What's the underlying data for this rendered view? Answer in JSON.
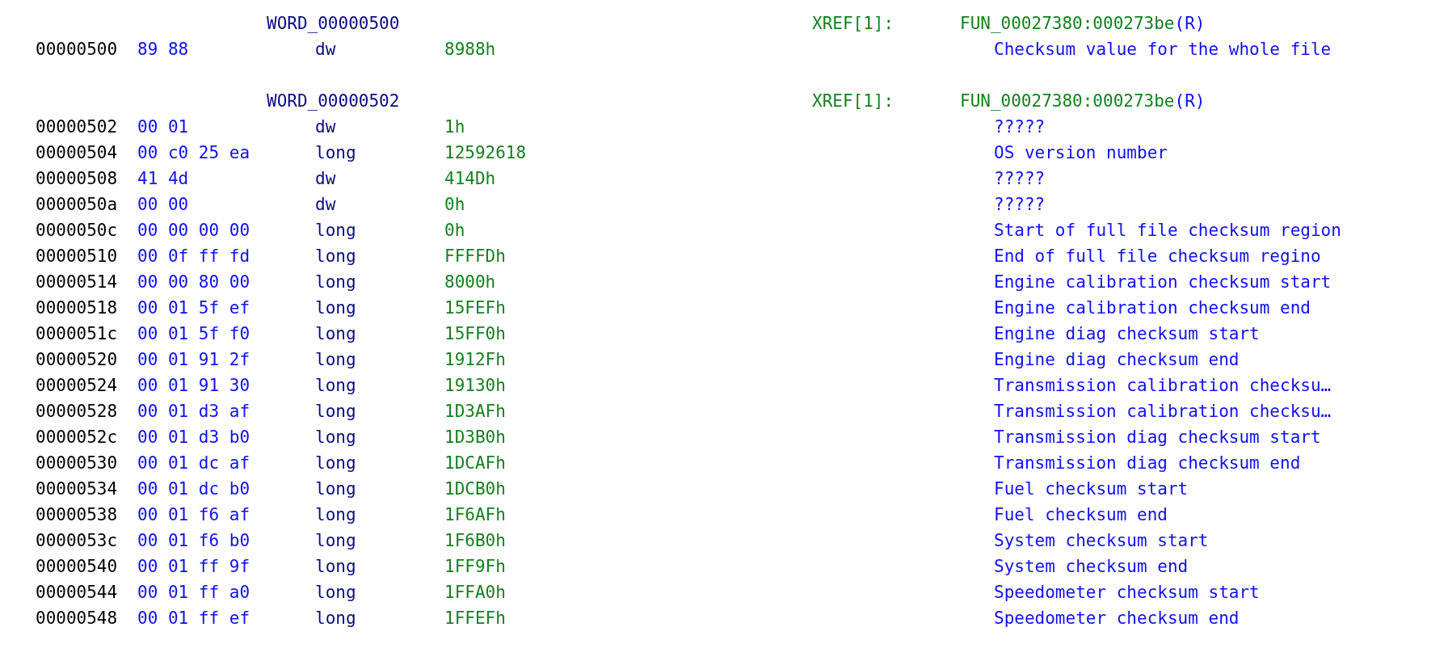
{
  "listing": [
    {
      "kind": "label",
      "label": "WORD_00000500",
      "xref_label": "XREF[1]:",
      "xref": "FUN_00027380:000273be",
      "access": "(R)"
    },
    {
      "kind": "data",
      "address": "00000500",
      "bytes": "89 88",
      "mnemonic": "dw",
      "operand": "8988h",
      "comment": "Checksum value for the whole file"
    },
    {
      "kind": "blank"
    },
    {
      "kind": "label",
      "label": "WORD_00000502",
      "xref_label": "XREF[1]:",
      "xref": "FUN_00027380:000273be",
      "access": "(R)"
    },
    {
      "kind": "data",
      "address": "00000502",
      "bytes": "00 01",
      "mnemonic": "dw",
      "operand": "1h",
      "comment": "?????"
    },
    {
      "kind": "data",
      "address": "00000504",
      "bytes": "00 c0 25 ea",
      "mnemonic": "long",
      "operand": "12592618",
      "comment": "OS version number"
    },
    {
      "kind": "data",
      "address": "00000508",
      "bytes": "41 4d",
      "mnemonic": "dw",
      "operand": "414Dh",
      "comment": "?????"
    },
    {
      "kind": "data",
      "address": "0000050a",
      "bytes": "00 00",
      "mnemonic": "dw",
      "operand": "0h",
      "comment": "?????"
    },
    {
      "kind": "data",
      "address": "0000050c",
      "bytes": "00 00 00 00",
      "mnemonic": "long",
      "operand": "0h",
      "comment": "Start of full file checksum region"
    },
    {
      "kind": "data",
      "address": "00000510",
      "bytes": "00 0f ff fd",
      "mnemonic": "long",
      "operand": "FFFFDh",
      "comment": "End of full file checksum regino"
    },
    {
      "kind": "data",
      "address": "00000514",
      "bytes": "00 00 80 00",
      "mnemonic": "long",
      "operand": "8000h",
      "comment": "Engine calibration checksum start"
    },
    {
      "kind": "data",
      "address": "00000518",
      "bytes": "00 01 5f ef",
      "mnemonic": "long",
      "operand": "15FEFh",
      "comment": "Engine calibration checksum end"
    },
    {
      "kind": "data",
      "address": "0000051c",
      "bytes": "00 01 5f f0",
      "mnemonic": "long",
      "operand": "15FF0h",
      "comment": "Engine diag checksum start"
    },
    {
      "kind": "data",
      "address": "00000520",
      "bytes": "00 01 91 2f",
      "mnemonic": "long",
      "operand": "1912Fh",
      "comment": "Engine diag checksum end"
    },
    {
      "kind": "data",
      "address": "00000524",
      "bytes": "00 01 91 30",
      "mnemonic": "long",
      "operand": "19130h",
      "comment": "Transmission calibration checksu…"
    },
    {
      "kind": "data",
      "address": "00000528",
      "bytes": "00 01 d3 af",
      "mnemonic": "long",
      "operand": "1D3AFh",
      "comment": "Transmission calibration checksu…"
    },
    {
      "kind": "data",
      "address": "0000052c",
      "bytes": "00 01 d3 b0",
      "mnemonic": "long",
      "operand": "1D3B0h",
      "comment": "Transmission diag checksum start"
    },
    {
      "kind": "data",
      "address": "00000530",
      "bytes": "00 01 dc af",
      "mnemonic": "long",
      "operand": "1DCAFh",
      "comment": "Transmission diag checksum end"
    },
    {
      "kind": "data",
      "address": "00000534",
      "bytes": "00 01 dc b0",
      "mnemonic": "long",
      "operand": "1DCB0h",
      "comment": "Fuel checksum start"
    },
    {
      "kind": "data",
      "address": "00000538",
      "bytes": "00 01 f6 af",
      "mnemonic": "long",
      "operand": "1F6AFh",
      "comment": "Fuel checksum end"
    },
    {
      "kind": "data",
      "address": "0000053c",
      "bytes": "00 01 f6 b0",
      "mnemonic": "long",
      "operand": "1F6B0h",
      "comment": "System checksum start"
    },
    {
      "kind": "data",
      "address": "00000540",
      "bytes": "00 01 ff 9f",
      "mnemonic": "long",
      "operand": "1FF9Fh",
      "comment": "System checksum end"
    },
    {
      "kind": "data",
      "address": "00000544",
      "bytes": "00 01 ff a0",
      "mnemonic": "long",
      "operand": "1FFA0h",
      "comment": "Speedometer checksum start"
    },
    {
      "kind": "data",
      "address": "00000548",
      "bytes": "00 01 ff ef",
      "mnemonic": "long",
      "operand": "1FFEFh",
      "comment": "Speedometer checksum end"
    }
  ]
}
